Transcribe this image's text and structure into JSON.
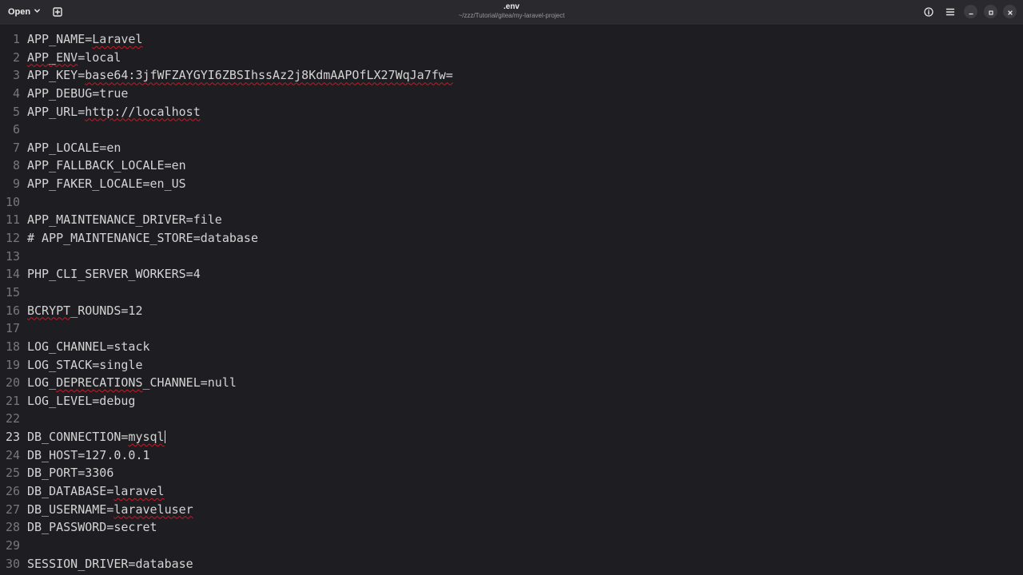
{
  "header": {
    "open_label": "Open",
    "title": ".env",
    "subtitle": "~/zzz/Tutorial/gitea/my-laravel-project"
  },
  "editor": {
    "current_line": 23,
    "lines": [
      {
        "n": "1",
        "parts": [
          {
            "t": "APP_NAME="
          },
          {
            "t": "Laravel",
            "spell": true
          }
        ]
      },
      {
        "n": "2",
        "parts": [
          {
            "t": "APP_ENV",
            "spell": true
          },
          {
            "t": "=local"
          }
        ]
      },
      {
        "n": "3",
        "parts": [
          {
            "t": "APP_KEY="
          },
          {
            "t": "base64:3jfWFZAYGYI6ZBSIhssAz2j8KdmAAPOfLX27WqJa7fw=",
            "spell": true
          }
        ]
      },
      {
        "n": "4",
        "parts": [
          {
            "t": "APP_DEBUG=true"
          }
        ]
      },
      {
        "n": "5",
        "parts": [
          {
            "t": "APP_URL="
          },
          {
            "t": "http://localhost",
            "spell": true
          }
        ]
      },
      {
        "n": "6",
        "parts": []
      },
      {
        "n": "7",
        "parts": [
          {
            "t": "APP_LOCALE=en"
          }
        ]
      },
      {
        "n": "8",
        "parts": [
          {
            "t": "APP_FALLBACK_LOCALE=en"
          }
        ]
      },
      {
        "n": "9",
        "parts": [
          {
            "t": "APP_FAKER_LOCALE=en_US"
          }
        ]
      },
      {
        "n": "10",
        "parts": []
      },
      {
        "n": "11",
        "parts": [
          {
            "t": "APP_MAINTENANCE_DRIVER=file"
          }
        ]
      },
      {
        "n": "12",
        "parts": [
          {
            "t": "# APP_MAINTENANCE_STORE=database"
          }
        ]
      },
      {
        "n": "13",
        "parts": []
      },
      {
        "n": "14",
        "parts": [
          {
            "t": "PHP_CLI_SERVER_WORKERS=4"
          }
        ]
      },
      {
        "n": "15",
        "parts": []
      },
      {
        "n": "16",
        "parts": [
          {
            "t": "BCRYPT",
            "spell": true
          },
          {
            "t": "_ROUNDS=12"
          }
        ]
      },
      {
        "n": "17",
        "parts": []
      },
      {
        "n": "18",
        "parts": [
          {
            "t": "LOG_CHANNEL=stack"
          }
        ]
      },
      {
        "n": "19",
        "parts": [
          {
            "t": "LOG_STACK=single"
          }
        ]
      },
      {
        "n": "20",
        "parts": [
          {
            "t": "LOG_"
          },
          {
            "t": "DEPRECATIONS",
            "spell": true
          },
          {
            "t": "_CHANNEL=null"
          }
        ]
      },
      {
        "n": "21",
        "parts": [
          {
            "t": "LOG_LEVEL=debug"
          }
        ]
      },
      {
        "n": "22",
        "parts": []
      },
      {
        "n": "23",
        "parts": [
          {
            "t": "DB_CONNECTION="
          },
          {
            "t": "mysql",
            "spell": true
          }
        ],
        "caret": true
      },
      {
        "n": "24",
        "parts": [
          {
            "t": "DB_HOST=127.0.0.1"
          }
        ]
      },
      {
        "n": "25",
        "parts": [
          {
            "t": "DB_PORT=3306"
          }
        ]
      },
      {
        "n": "26",
        "parts": [
          {
            "t": "DB_DATABASE="
          },
          {
            "t": "laravel",
            "spell": true
          }
        ]
      },
      {
        "n": "27",
        "parts": [
          {
            "t": "DB_USERNAME="
          },
          {
            "t": "laraveluser",
            "spell": true
          }
        ]
      },
      {
        "n": "28",
        "parts": [
          {
            "t": "DB_PASSWORD=secret"
          }
        ]
      },
      {
        "n": "29",
        "parts": []
      },
      {
        "n": "30",
        "parts": [
          {
            "t": "SESSION_DRIVER=database"
          }
        ]
      }
    ]
  },
  "icons": {
    "open_dropdown": "chevron-down-icon",
    "new_tab": "new-tab-icon",
    "document_properties": "info-icon",
    "main_menu": "hamburger-menu-icon",
    "minimize": "minimize-icon",
    "maximize": "maximize-icon",
    "close": "close-icon"
  },
  "colors": {
    "background": "#1e1e22",
    "headerbar": "#2a2a2e",
    "text": "#d4d4d4",
    "line_numbers": "#77777c",
    "spellcheck_underline": "#c01c28"
  }
}
